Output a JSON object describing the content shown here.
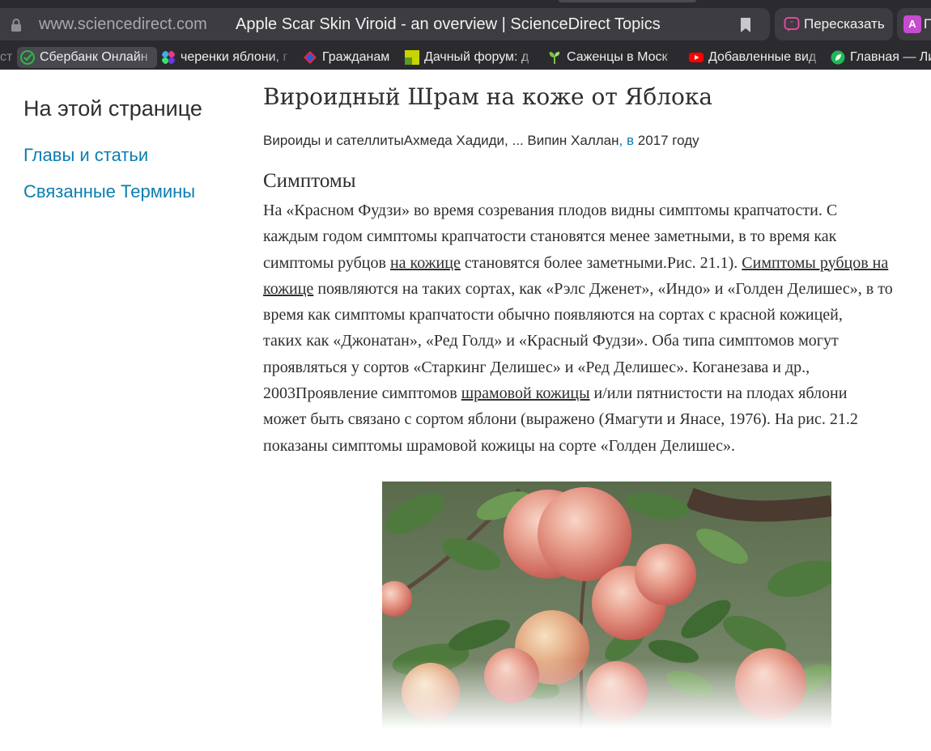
{
  "browser": {
    "url": "www.sciencedirect.com",
    "tab_title": "Apple Scar Skin Viroid - an overview | ScienceDirect Topics",
    "retell_label": "Пересказать",
    "translate_label": "П",
    "translate_icon_text": "A",
    "bookmarks_partial": "ст",
    "bookmarks": [
      {
        "label": "Сбербанк Онлайн",
        "icon": "sberbank-icon",
        "color": "#2fb54a"
      },
      {
        "label": "черенки яблони, г",
        "icon": "dots-icon",
        "color": "#3ab0e6"
      },
      {
        "label": "Гражданам",
        "icon": "gosuslugi-icon",
        "color": "#e0284a"
      },
      {
        "label": "Дачный форум: д",
        "icon": "forum-icon",
        "color": "#c8d400"
      },
      {
        "label": "Саженцы в Моск",
        "icon": "sprout-icon",
        "color": "#7cc243"
      },
      {
        "label": "Добавленные вид",
        "icon": "youtube-icon",
        "color": "#ff0000"
      },
      {
        "label": "Главная — Ли",
        "icon": "leaf-icon",
        "color": "#1db954"
      }
    ]
  },
  "sidebar": {
    "heading": "На этой странице",
    "links": [
      "Главы и статьи",
      "Связанные Термины"
    ]
  },
  "article": {
    "title": "Вироидный Шрам на коже от Яблока",
    "byline_source": "Вироиды и сателлитыАхмеда Хадиди, ... Випин Халлан",
    "byline_sep": ", в",
    "byline_year": " 2017 году",
    "section_heading": "Симптомы",
    "paragraph_lines": {
      "l1": "На «Красном Фудзи» во время созревания плодов видны симптомы крапчатости. С",
      "l2": "каждым годом симптомы крапчатости становятся менее заметными, в то время как",
      "l3a": "симптомы рубцов ",
      "l3_link": "на кожице",
      "l3b": " становятся более заметными.Рис. 21.1). ",
      "l3_link2": "Симптомы рубцов на",
      "l4_link": "кожице",
      "l4b": " появляются на таких сортах, как «Рэлс Дженет», «Индо» и «Голден Делишес», в то",
      "l5": "время как симптомы крапчатости обычно появляются на сортах с красной кожицей,",
      "l6": "таких как «Джонатан», «Ред Голд» и «Красный Фудзи». Оба типа симптомов могут",
      "l7": "проявляться у сортов «Старкинг Делишес» и «Ред Делишес». Коганезава и др.,",
      "l8a": "2003Проявление симптомов ",
      "l8_link": "шрамовой кожицы",
      "l8b": " и/или пятнистости на плодах яблони",
      "l9": "может быть связано с сортом яблони (выражено (Ямагути и Янасе, 1976). На рис. 21.2",
      "l10": "показаны симптомы шрамовой кожицы на сорте «Голден Делишес»."
    }
  },
  "colors": {
    "chrome_bg": "#2b2b2f",
    "omnibox_bg": "#3c3c41",
    "link_blue": "#0c7db1",
    "text": "#2e2e2e"
  }
}
